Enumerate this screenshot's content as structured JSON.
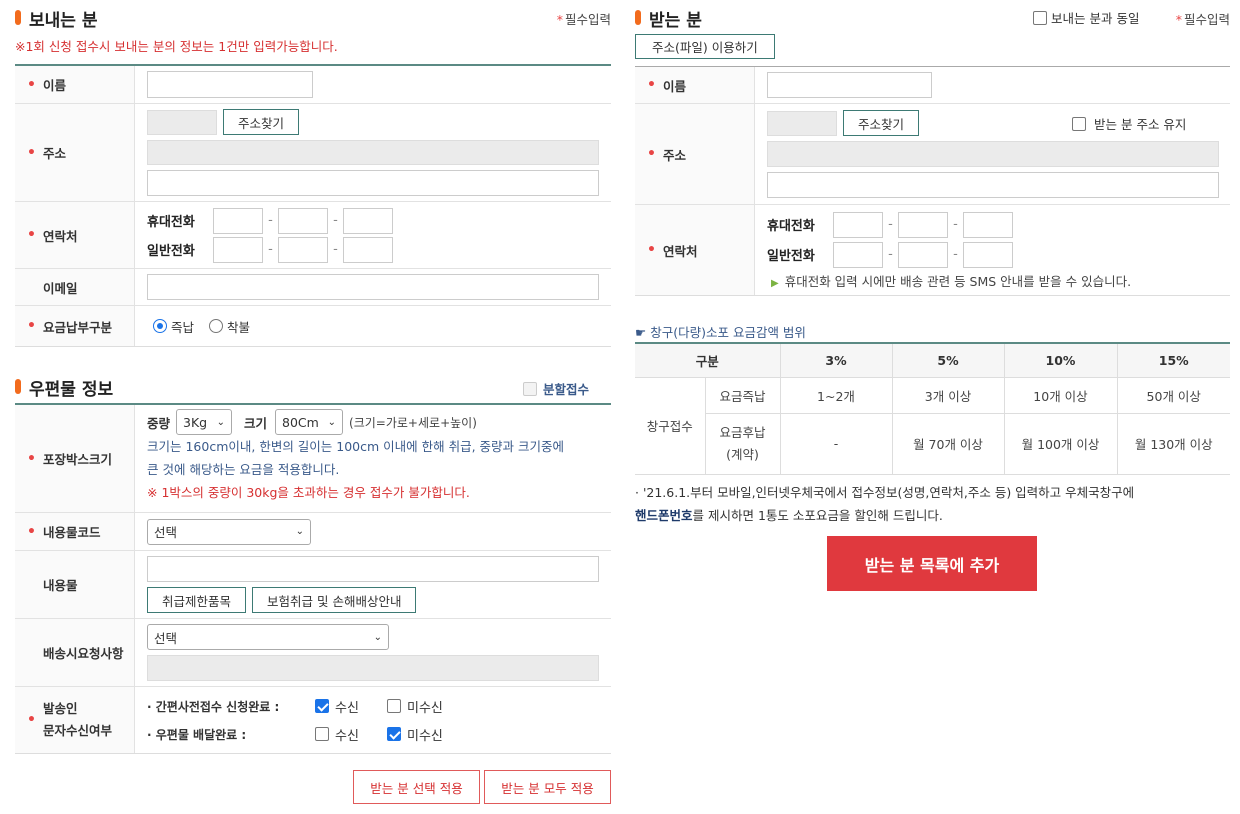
{
  "sender": {
    "title": "보내는 분",
    "required_note": "필수입력",
    "warning": "※1회 신청 접수시 보내는 분의 정보는 1건만 입력가능합니다.",
    "name_label": "이름",
    "address_label": "주소",
    "address_search_button": "주소찾기",
    "contact_label": "연락처",
    "mobile_label": "휴대전화",
    "phone_label": "일반전화",
    "email_label": "이메일",
    "payment_label": "요금납부구분",
    "payment_options": [
      "즉납",
      "착불"
    ],
    "payment_selected": "즉납"
  },
  "parcel": {
    "title": "우편물 정보",
    "split_label": "분할접수",
    "box_size_label": "포장박스크기",
    "weight_label": "중량",
    "weight_value": "3Kg",
    "size_label": "크기",
    "size_value": "80Cm",
    "size_formula": "(크기=가로+세로+높이)",
    "size_note_1": "크기는 160cm이내, 한변의 길이는 100cm 이내에 한해 취급, 중량과 크기중에",
    "size_note_2": "큰 것에 해당하는 요금을 적용합니다.",
    "size_warning": "※ 1박스의 중량이 30kg을 초과하는 경우 접수가 불가합니다.",
    "content_code_label": "내용물코드",
    "content_code_value": "선택",
    "content_label": "내용물",
    "restricted_button": "취급제한품목",
    "insurance_button": "보험취급 및 손해배상안내",
    "delivery_request_label": "배송시요청사항",
    "delivery_request_value": "선택",
    "sms_label_1": "발송인",
    "sms_label_2": "문자수신여부",
    "sms_item_1": "· 간편사전접수 신청완료 :",
    "sms_item_2": "· 우편물 배달완료 :",
    "receive_label": "수신",
    "no_receive_label": "미수신"
  },
  "bottom_buttons": {
    "apply_selected": "받는 분 선택 적용",
    "apply_all": "받는 분 모두 적용"
  },
  "receiver": {
    "title": "받는 분",
    "same_as_sender": "보내는 분과 동일",
    "required_note": "필수입력",
    "file_button": "주소(파일) 이용하기",
    "name_label": "이름",
    "address_label": "주소",
    "address_search_button": "주소찾기",
    "keep_address": "받는 분 주소 유지",
    "contact_label": "연락처",
    "mobile_label": "휴대전화",
    "phone_label": "일반전화",
    "sms_note": "휴대전화 입력 시에만 배송 관련 등 SMS 안내를 받을 수 있습니다."
  },
  "discount": {
    "title": "창구(다량)소포 요금감액 범위",
    "header": [
      "구분",
      "3%",
      "5%",
      "10%",
      "15%"
    ],
    "group_label": "창구접수",
    "rows": [
      {
        "type": "요금즉납",
        "values": [
          "1~2개",
          "3개 이상",
          "10개 이상",
          "50개 이상"
        ]
      },
      {
        "type": "요금후납",
        "type_sub": "(계약)",
        "values": [
          "-",
          "월 70개 이상",
          "월 100개 이상",
          "월 130개 이상"
        ]
      }
    ],
    "note_1": "· '21.6.1.부터 모바일,인터넷우체국에서 접수정보(성명,연락처,주소 등) 입력하고 우체국창구에",
    "note_2_bold": "핸드폰번호",
    "note_2_rest": "를 제시하면 1통도 소포요금을 할인해 드립니다."
  },
  "add_button": "받는 분 목록에 추가",
  "colors": {
    "accent_orange": "#f26b1d",
    "teal_border": "#3d7a74",
    "required_red": "#e84545",
    "primary_red": "#e0393e",
    "check_blue": "#1a73e8"
  }
}
